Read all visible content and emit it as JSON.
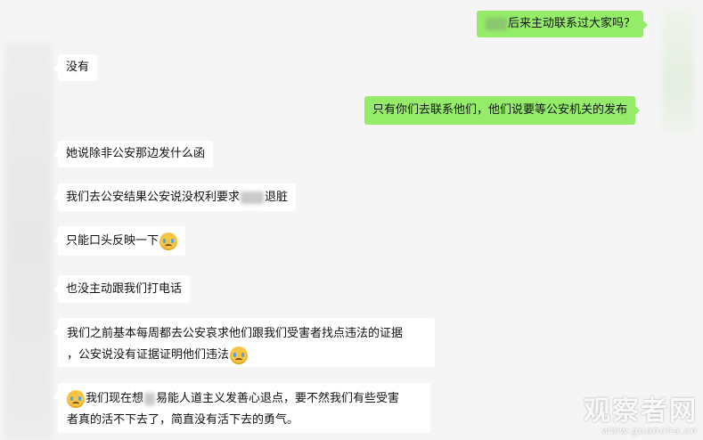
{
  "messages": [
    {
      "side": "out",
      "parts": [
        "",
        "后来主动联系过大家吗？"
      ]
    },
    {
      "side": "in",
      "parts": [
        "没有"
      ]
    },
    {
      "side": "out",
      "parts": [
        "只有你们去联系他们，他们说要等公安机关的发布"
      ]
    },
    {
      "side": "in",
      "parts": [
        "她说除非公安那边发什么函"
      ]
    },
    {
      "side": "in",
      "parts": [
        "我们去公安结果公安说没权利要求",
        "退脏"
      ]
    },
    {
      "side": "in",
      "parts": [
        "只能口头反映一下"
      ],
      "emoji": "crying-face"
    },
    {
      "side": "in",
      "parts": [
        "也没主动跟我们打电话"
      ]
    },
    {
      "side": "in",
      "parts": [
        "我们之前基本每周都去公安哀求他们跟我们受害者找点违法的证据",
        "，公安说没有证据证明他们违法"
      ],
      "emoji": "crying-face"
    },
    {
      "side": "in",
      "parts": [
        "我们现在想",
        "易能人道主义发善心退点，要不然我们有些受害",
        "者真的活不下去了，简直没有活下去的勇气。"
      ],
      "emoji": "crying-face"
    }
  ],
  "watermark": {
    "text": "观察者网",
    "url": "www.guancha.cn"
  },
  "colors": {
    "background": "#f5f5f5",
    "outgoing_bubble": "#95ec69",
    "incoming_bubble": "#ffffff"
  }
}
